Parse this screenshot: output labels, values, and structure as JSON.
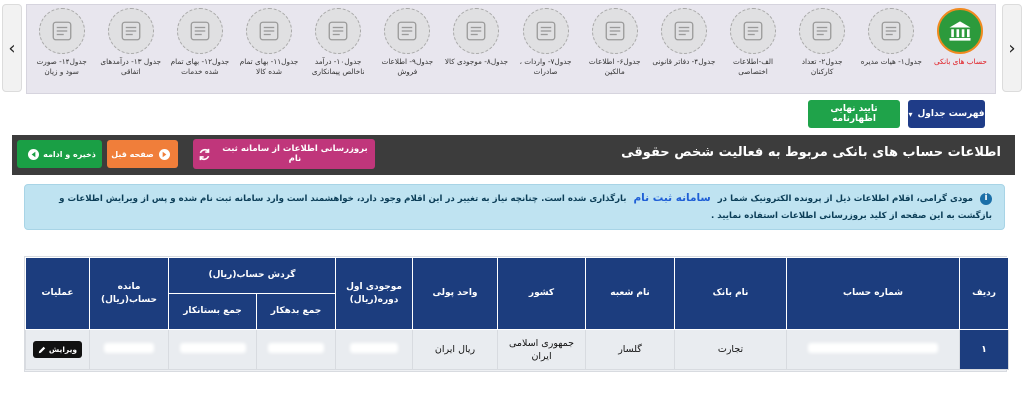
{
  "carousel": {
    "prev_arrow": "‹",
    "next_arrow": "›",
    "steps": [
      {
        "label": "حساب های بانکی",
        "icon": "bank-icon",
        "active": true
      },
      {
        "label": "جدول۱- هیات مدیره",
        "icon": "board-icon"
      },
      {
        "label": "جدول۲- تعداد کارکنان",
        "icon": "staff-icon"
      },
      {
        "label": "الف-اطلاعات اختصاصی",
        "icon": "id-card-icon"
      },
      {
        "label": "جدول۴- دفاتر قانونی",
        "icon": "ledger-icon"
      },
      {
        "label": "جدول۶- اطلاعات مالکین",
        "icon": "building-icon"
      },
      {
        "label": "جدول۷- واردات ، صادرات",
        "icon": "import-export-icon"
      },
      {
        "label": "جدول۸- موجودی کالا",
        "icon": "inventory-icon"
      },
      {
        "label": "جدول۹- اطلاعات فروش",
        "icon": "sales-icon"
      },
      {
        "label": "جدول۱۰- درآمد ناخالص پیمانکاری",
        "icon": "contract-icon"
      },
      {
        "label": "جدول۱۱- بهای تمام شده کالا",
        "icon": "calculator-icon"
      },
      {
        "label": "جدول۱۲- بهای تمام شده خدمات",
        "icon": "services-icon"
      },
      {
        "label": "جدول ۱۳- درآمدهای اتفاقی",
        "icon": "income-icon"
      },
      {
        "label": "جدول۱۴- صورت سود و زیان",
        "icon": "scale-icon"
      }
    ]
  },
  "toolbar": {
    "list_label": "فهرست جداول",
    "confirm_label": "تایید نهایی اظهارنامه"
  },
  "section": {
    "title": "اطلاعات حساب های بانکی مربوط به فعالیت شخص حقوقی",
    "sync_label": "بروزرسانی اطلاعات از سامانه ثبت نام",
    "prev_label": "صفحه قبل",
    "save_label": "ذخیره و ادامه"
  },
  "alert": {
    "icon": "info-icon",
    "text_before": "مودی گرامی، اقلام اطلاعات ذیل از پرونده الکترونیک شما در",
    "link_text": "سامانه ثبت نام",
    "text_after": "بارگذاری شده است. چنانچه نیاز به تغییر در این اقلام وجود دارد، خواهشمند است وارد سامانه ثبت نام شده و پس از ویرایش اطلاعات و بازگشت به این صفحه از کلید بروزرسانی اطلاعات استفاده نمایید ."
  },
  "table": {
    "headers": {
      "row": "ردیف",
      "account_number": "شماره حساب",
      "bank_name": "نام بانک",
      "branch_name": "نام شعبه",
      "country": "کشور",
      "currency": "واحد پولی",
      "opening_balance": "موجودی اول دوره(ریال)",
      "turnover_group": "گردش حساب(ریال)",
      "total_debit": "جمع بدهکار",
      "total_credit": "جمع بستانکار",
      "account_balance": "مانده حساب(ریال)",
      "operations": "عملیات"
    },
    "rows": [
      {
        "row": "۱",
        "bank_name": "تجارت",
        "branch_name": "گلسار",
        "country": "جمهوری اسلامی ایران",
        "currency": "ریال ایران",
        "edit_label": "ویرایش"
      }
    ]
  },
  "colors": {
    "accent_blue": "#1c3d7e",
    "confirm_green": "#1fa34a",
    "sync_magenta": "#c0367b",
    "prev_orange": "#f07e3a",
    "alert_bg": "#bfe3f1",
    "active_step": "#2c9a3c"
  }
}
